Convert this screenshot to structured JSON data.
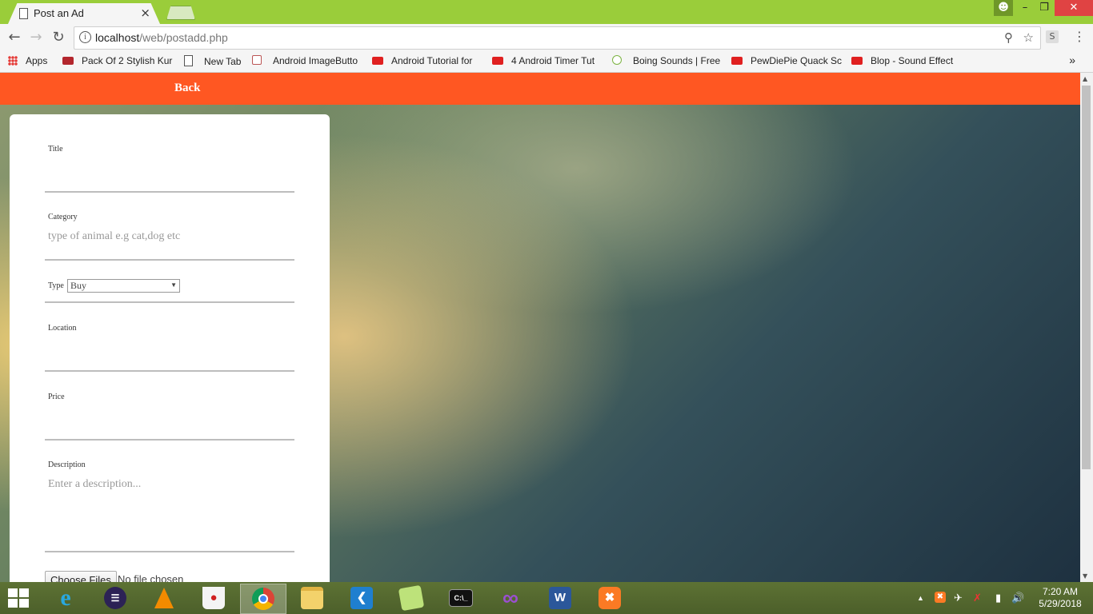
{
  "browser": {
    "tab_title": "Post an Ad",
    "tab_close": "×",
    "url_host": "localhost",
    "url_path": "/web/postadd.php",
    "extension_label": "S",
    "window_controls": {
      "minimize": "–",
      "maximize": "❐",
      "close": "✕"
    }
  },
  "bookmarks": [
    {
      "label": "Apps",
      "icon": "apps-grid-icon"
    },
    {
      "label": "Pack Of 2 Stylish Kur",
      "icon": "shop-icon"
    },
    {
      "label": "New Tab",
      "icon": "page-icon"
    },
    {
      "label": "Android ImageButto",
      "icon": "android-icon"
    },
    {
      "label": "Android Tutorial for",
      "icon": "youtube-icon"
    },
    {
      "label": "4 Android Timer Tut",
      "icon": "youtube-icon"
    },
    {
      "label": "Boing Sounds | Free",
      "icon": "sound-icon"
    },
    {
      "label": "PewDiePie Quack Sc",
      "icon": "youtube-icon"
    },
    {
      "label": "Blop - Sound Effect",
      "icon": "youtube-icon"
    }
  ],
  "navbar": {
    "back_label": "Back"
  },
  "form": {
    "title_label": "Title",
    "title_value": "",
    "category_label": "Category",
    "category_placeholder": "type of animal e.g cat,dog etc",
    "type_label": "Type",
    "type_selected": "Buy",
    "location_label": "Location",
    "price_label": "Price",
    "description_label": "Description",
    "description_placeholder": "Enter a description...",
    "choose_files_label": "Choose Files",
    "no_file_text": "No file chosen"
  },
  "taskbar": {
    "apps": [
      "internet-explorer",
      "eclipse",
      "vlc",
      "popcorn-time",
      "chrome",
      "file-explorer",
      "vs-code",
      "sticky-notes",
      "command-prompt",
      "visual-studio",
      "word",
      "xampp"
    ],
    "active_app": "chrome",
    "time": "7:20 AM",
    "date": "5/29/2018"
  }
}
